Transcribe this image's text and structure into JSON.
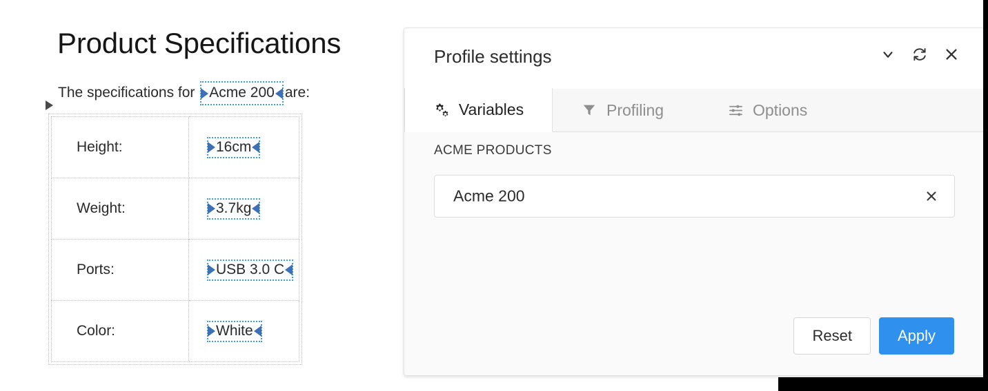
{
  "document": {
    "title": "Product Specifications",
    "paragraph": {
      "before": "The specifications for",
      "highlight": "Acme 200",
      "after": "are:"
    },
    "table": {
      "rows": [
        {
          "label": "Height:",
          "value": "16cm"
        },
        {
          "label": "Weight:",
          "value": "3.7kg"
        },
        {
          "label": "Ports:",
          "value": "USB 3.0 C"
        },
        {
          "label": "Color:",
          "value": "White"
        }
      ]
    },
    "caret_icon": "triangle-right-icon"
  },
  "dialog": {
    "title": "Profile settings",
    "header_actions": [
      {
        "name": "chevron-down-icon",
        "label": "Collapse"
      },
      {
        "name": "refresh-icon",
        "label": "Refresh"
      },
      {
        "name": "close-icon",
        "label": "Close"
      }
    ],
    "tabs": [
      {
        "label": "Variables",
        "icon": "cogs-icon",
        "active": true
      },
      {
        "label": "Profiling",
        "icon": "filter-icon",
        "active": false
      },
      {
        "label": "Options",
        "icon": "sliders-icon",
        "active": false
      }
    ],
    "field": {
      "label": "ACME PRODUCTS",
      "value": "Acme 200",
      "placeholder": "",
      "clear_icon": "clear-x-icon"
    },
    "buttons": {
      "reset": "Reset",
      "apply": "Apply"
    }
  },
  "colors": {
    "accent_blue": "#2f90ee",
    "selection_blue": "#3b9bf0",
    "selection_marker": "#3f6fb5",
    "dialog_body": "#fafafa",
    "border_gray": "#e0e0e0"
  }
}
